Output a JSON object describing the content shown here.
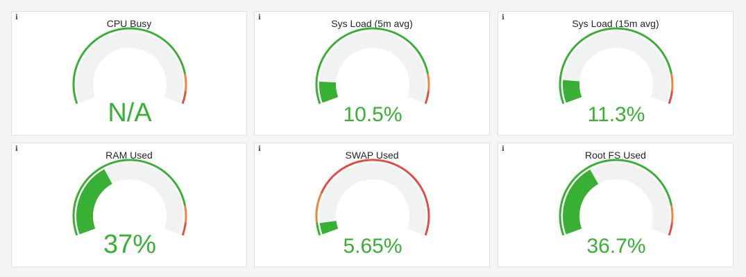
{
  "panels": [
    {
      "title": "CPU Busy",
      "value_text": "N/A",
      "fill_fraction": 0,
      "thresholds": [
        "#37b034",
        "#37b034",
        "#37b034",
        "#ef843c",
        "#e24d42"
      ],
      "info_icon": "info-icon"
    },
    {
      "title": "Sys Load (5m avg)",
      "value_text": "10.5%",
      "fill_fraction": 0.105,
      "thresholds": [
        "#37b034",
        "#37b034",
        "#37b034",
        "#ef843c",
        "#e24d42"
      ],
      "info_icon": "info-icon"
    },
    {
      "title": "Sys Load (15m avg)",
      "value_text": "11.3%",
      "fill_fraction": 0.113,
      "thresholds": [
        "#37b034",
        "#37b034",
        "#37b034",
        "#ef843c",
        "#e24d42"
      ],
      "info_icon": "info-icon"
    },
    {
      "title": "RAM Used",
      "value_text": "37%",
      "fill_fraction": 0.37,
      "thresholds": [
        "#37b034",
        "#37b034",
        "#37b034",
        "#ef843c",
        "#e24d42"
      ],
      "info_icon": "info-icon"
    },
    {
      "title": "SWAP Used",
      "value_text": "5.65%",
      "fill_fraction": 0.0565,
      "thresholds": [
        "#37b034",
        "#ef843c",
        "#e24d42",
        "#e24d42",
        "#e24d42"
      ],
      "info_icon": "info-icon"
    },
    {
      "title": "Root FS Used",
      "value_text": "36.7%",
      "fill_fraction": 0.367,
      "thresholds": [
        "#37b034",
        "#37b034",
        "#37b034",
        "#ef843c",
        "#e24d42"
      ],
      "info_icon": "info-icon"
    }
  ],
  "colors": {
    "value": "#37b034",
    "track": "#f1f2f2",
    "green": "#37b034",
    "orange": "#ef843c",
    "red": "#e24d42"
  }
}
